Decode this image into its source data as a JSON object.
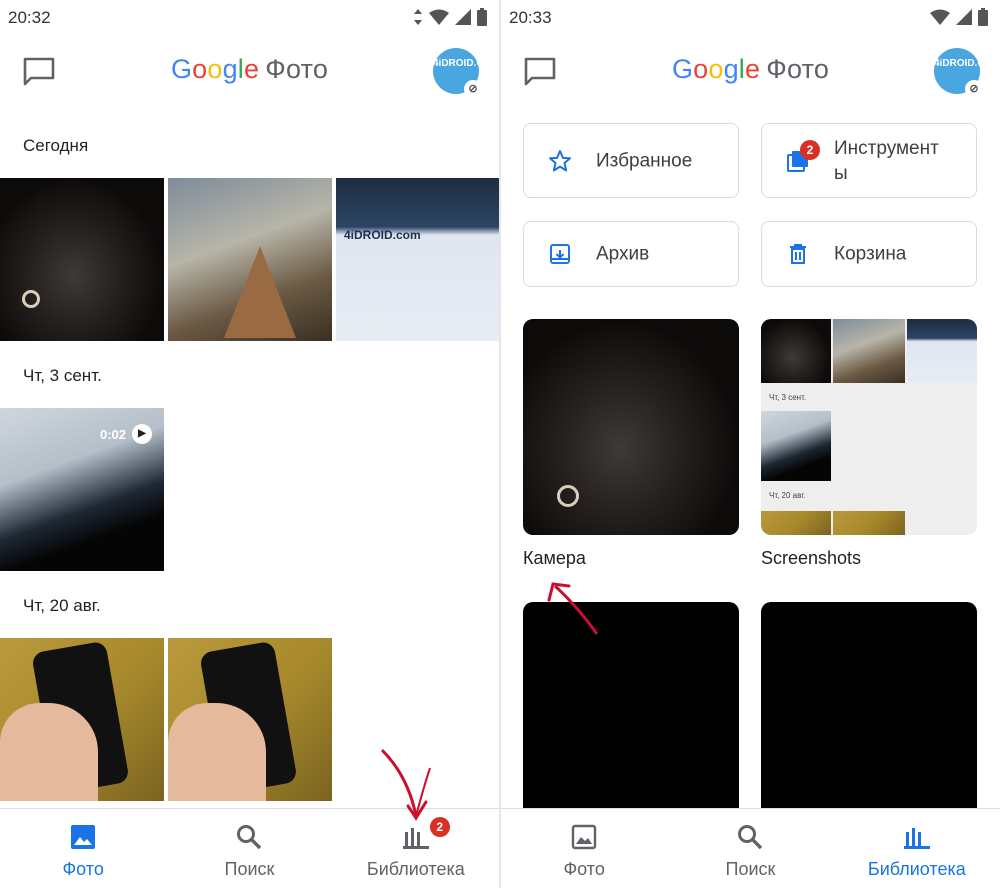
{
  "left": {
    "status_time": "20:32",
    "logo_google": [
      "G",
      "o",
      "o",
      "g",
      "l",
      "e"
    ],
    "logo_app": "Фото",
    "avatar_text": "4iDROID.COM",
    "sections": [
      {
        "label": "Сегодня"
      },
      {
        "label": "Чт, 3 сент."
      },
      {
        "label": "Чт, 20 авг."
      }
    ],
    "video_duration": "0:02",
    "site_text": "4iDROID.com",
    "nav": [
      {
        "label": "Фото",
        "icon": "photo-icon",
        "active": true
      },
      {
        "label": "Поиск",
        "icon": "search-icon",
        "active": false
      },
      {
        "label": "Библиотека",
        "icon": "library-icon",
        "active": false,
        "badge": "2"
      }
    ]
  },
  "right": {
    "status_time": "20:33",
    "logo_google": [
      "G",
      "o",
      "o",
      "g",
      "l",
      "e"
    ],
    "logo_app": "Фото",
    "avatar_text": "4iDROID.COM",
    "tiles": [
      {
        "label": "Избранное",
        "icon": "star-icon"
      },
      {
        "label": "Инструмент\nы",
        "icon": "tools-icon",
        "badge": "2"
      },
      {
        "label": "Архив",
        "icon": "archive-icon"
      },
      {
        "label": "Корзина",
        "icon": "trash-icon"
      }
    ],
    "albums": [
      {
        "name": "Камера"
      },
      {
        "name": "Screenshots"
      }
    ],
    "shots_labels": [
      "Чт, 3 сент.",
      "Чт, 20 авг."
    ],
    "nav": [
      {
        "label": "Фото",
        "icon": "photo-icon",
        "active": false
      },
      {
        "label": "Поиск",
        "icon": "search-icon",
        "active": false
      },
      {
        "label": "Библиотека",
        "icon": "library-icon",
        "active": true
      }
    ]
  },
  "colors": {
    "accent": "#1a73e8",
    "badge": "#d93025",
    "annotation_arrow": "#c8102e"
  }
}
